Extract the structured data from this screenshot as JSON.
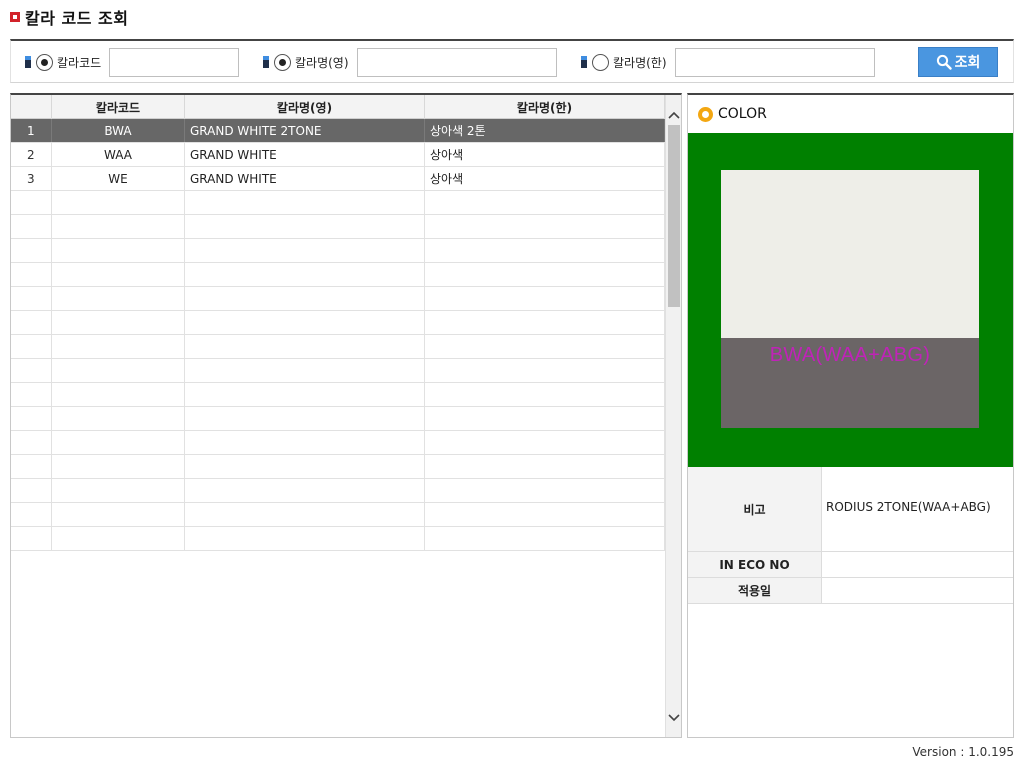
{
  "page": {
    "title": "칼라 코드 조회",
    "version": "Version : 1.0.195"
  },
  "search": {
    "fields": [
      {
        "label": "칼라코드",
        "selected": true,
        "value": ""
      },
      {
        "label": "칼라명(영)",
        "selected": true,
        "value": ""
      },
      {
        "label": "칼라명(한)",
        "selected": false,
        "value": ""
      }
    ],
    "button_label": "조회"
  },
  "grid": {
    "columns": [
      "",
      "칼라코드",
      "칼라명(영)",
      "칼라명(한)"
    ],
    "rows": [
      {
        "no": "1",
        "code": "BWA",
        "name_en": "GRAND WHITE 2TONE",
        "name_ko": "상아색 2톤"
      },
      {
        "no": "2",
        "code": "WAA",
        "name_en": "GRAND WHITE",
        "name_ko": "상아색"
      },
      {
        "no": "3",
        "code": "WE",
        "name_en": "GRAND WHITE",
        "name_ko": "상아색"
      }
    ],
    "selected_row": 0,
    "empty_rows": 15
  },
  "detail": {
    "title": "COLOR",
    "swatch_label": "BWA(WAA+ABG)",
    "colors": {
      "frame": "#008000",
      "top": "#eeeee8",
      "bottom": "#6b6566",
      "label": "#c023b8"
    },
    "fields": [
      {
        "label": "비고",
        "value": "RODIUS 2TONE(WAA+ABG)"
      },
      {
        "label": "IN ECO NO",
        "value": ""
      },
      {
        "label": "적용일",
        "value": ""
      }
    ]
  }
}
